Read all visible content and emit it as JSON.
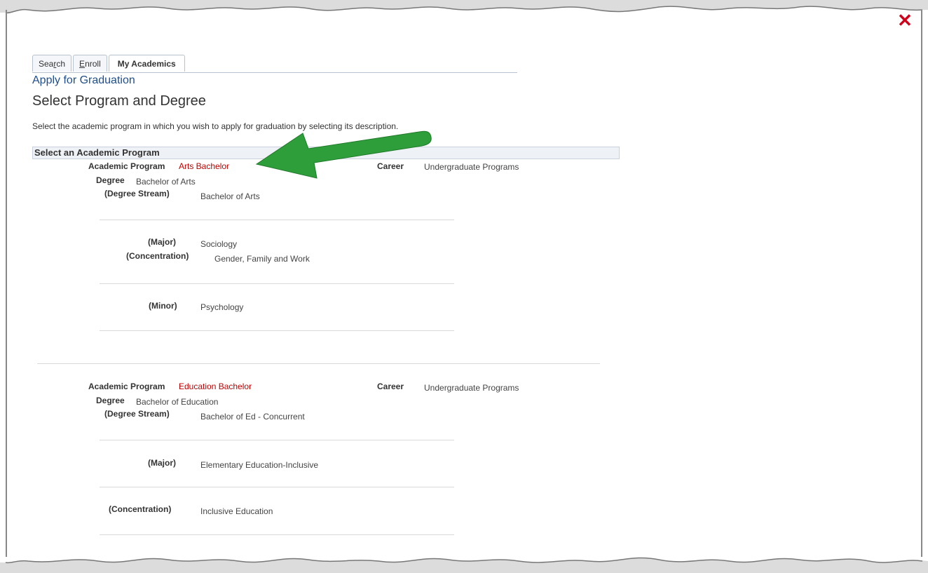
{
  "close": {
    "icon": "close-icon"
  },
  "tabs": [
    {
      "pre": "Sea",
      "ul": "r",
      "post": "ch"
    },
    {
      "pre": "",
      "ul": "E",
      "post": "nroll"
    },
    {
      "label": "My Academics"
    }
  ],
  "header": {
    "subtitle": "Apply for Graduation",
    "title": "Select Program and Degree",
    "instructions": "Select the academic program in which you wish to apply for graduation by selecting its description."
  },
  "section": {
    "title": "Select an Academic Program"
  },
  "labels": {
    "academic_program": "Academic Program",
    "career": "Career",
    "degree": "Degree",
    "degree_stream": "(Degree Stream)",
    "major": "(Major)",
    "concentration": "(Concentration)",
    "minor": "(Minor)"
  },
  "programs": [
    {
      "program": "Arts Bachelor",
      "career": "Undergraduate Programs",
      "degree": "Bachelor of Arts",
      "degree_stream": "Bachelor of Arts",
      "major": "Sociology",
      "concentration": "Gender, Family and Work",
      "minor": "Psychology"
    },
    {
      "program": "Education Bachelor",
      "career": "Undergraduate Programs",
      "degree": "Bachelor of Education",
      "degree_stream": "Bachelor of Ed - Concurrent",
      "major": "Elementary Education-Inclusive",
      "concentration": "Inclusive Education"
    }
  ],
  "annotation": {
    "icon": "green-arrow-icon",
    "color": "#2e9e3a"
  },
  "colors": {
    "link": "#c00000",
    "close": "#d0021b",
    "subtitle": "#1f4e8c"
  }
}
